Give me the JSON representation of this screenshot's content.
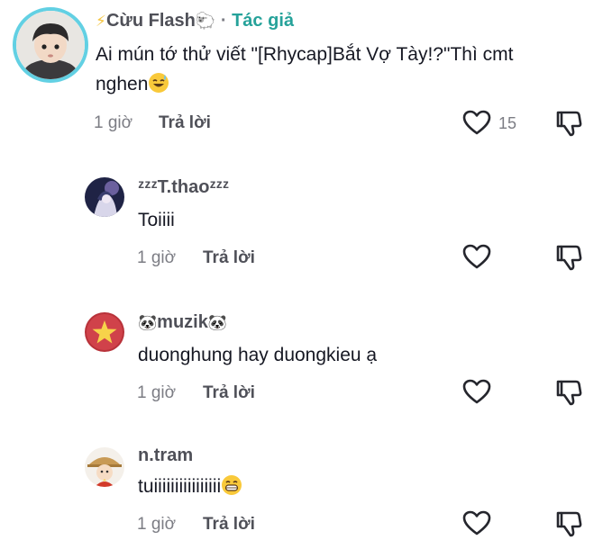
{
  "comments": [
    {
      "name_prefix": "⚡",
      "name": "Cừu Flash",
      "name_suffix": "🐑",
      "tag_sep": " · ",
      "author_tag": "Tác giả",
      "text": "Ai mún tớ thử viết \"[Rhycap]Bắt Vợ Tày!?\"Thì cmt nghen",
      "emoji": "sweat-smile",
      "time": "1 giờ",
      "reply": "Trả lời",
      "likes": "15"
    },
    {
      "name": "ᶻᶻᶻT.thaoᶻᶻᶻ",
      "text": "Toiiii",
      "time": "1 giờ",
      "reply": "Trả lời"
    },
    {
      "name_prefix": "🐼",
      "name": "muzik",
      "name_suffix": "🐼",
      "text": "duonghung hay duongkieu ạ",
      "time": "1 giờ",
      "reply": "Trả lời"
    },
    {
      "name": "n.tram",
      "text": "tuiiiiiiiiiiiiiiii",
      "emoji": "grin",
      "time": "1 giờ",
      "reply": "Trả lời"
    }
  ],
  "colors": {
    "author_tag": "#26a29a",
    "avatar_ring": "#62d0e3"
  }
}
